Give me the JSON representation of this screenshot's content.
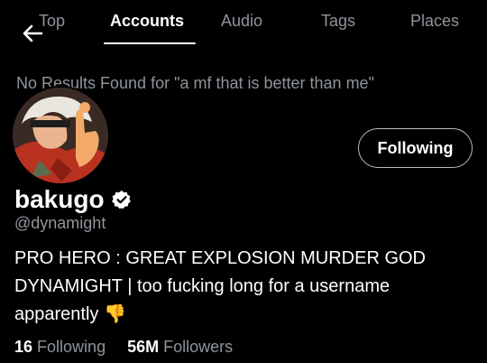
{
  "tabs": [
    {
      "label": "Top"
    },
    {
      "label": "Accounts"
    },
    {
      "label": "Audio"
    },
    {
      "label": "Tags"
    },
    {
      "label": "Places"
    }
  ],
  "no_results_text": "No Results Found for \"a mf that is better than me\"",
  "profile": {
    "display_name": "bakugo",
    "handle": "@dynamight",
    "bio": "PRO HERO : GREAT EXPLOSION MURDER GOD DYNAMIGHT | too fucking long for a username apparently 👎",
    "follow_button_label": "Following",
    "following_count": "16",
    "following_label": "Following",
    "followers_count": "56M",
    "followers_label": "Followers"
  },
  "icons": {
    "back": "arrow-left-icon",
    "verified": "verified-badge-icon"
  },
  "colors": {
    "background": "#000000",
    "primary_text": "#ffffff",
    "secondary_text": "#8f959b"
  }
}
